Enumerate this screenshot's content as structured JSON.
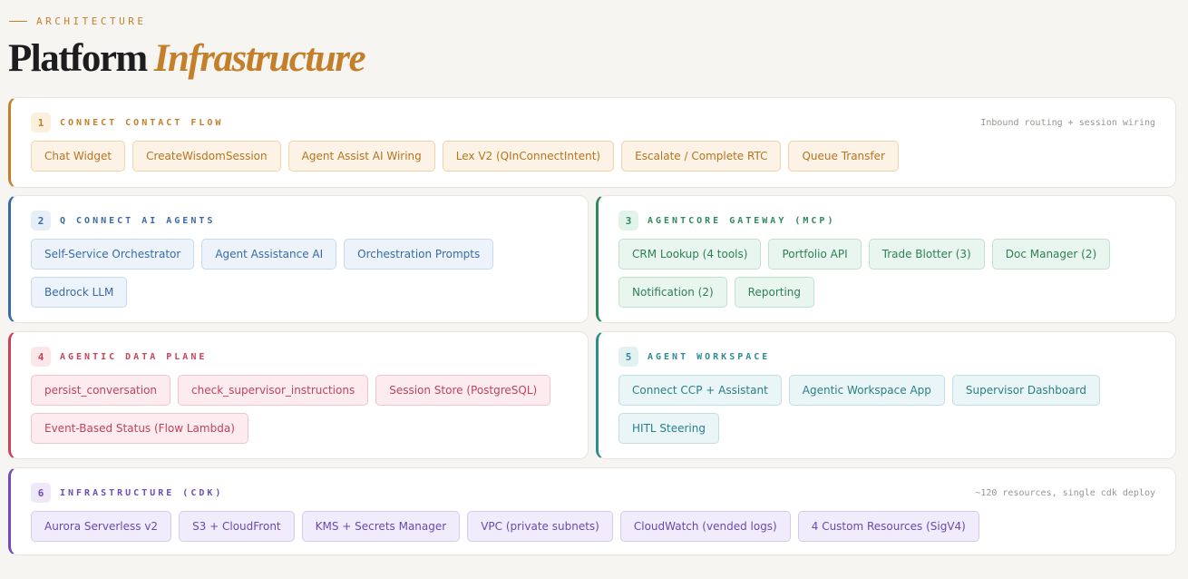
{
  "header": {
    "eyebrow": "ARCHITECTURE",
    "title_main": "Platform",
    "title_accent": "Infrastructure"
  },
  "colors": {
    "background": "#f7f5f1",
    "orange": "#c47f2a",
    "blue": "#3a6aa6",
    "green": "#2e8a5c",
    "red": "#c6455a",
    "teal": "#2f8a92",
    "purple": "#6f4cb8"
  },
  "sections": [
    {
      "number": "1",
      "title": "CONNECT CONTACT FLOW",
      "note": "Inbound routing + session wiring",
      "chips": [
        "Chat Widget",
        "CreateWisdomSession",
        "Agent Assist AI Wiring",
        "Lex V2 (QInConnectIntent)",
        "Escalate / Complete RTC",
        "Queue Transfer"
      ]
    },
    {
      "number": "2",
      "title": "Q CONNECT AI AGENTS",
      "note": "",
      "chips": [
        "Self-Service Orchestrator",
        "Agent Assistance AI",
        "Orchestration Prompts",
        "Bedrock LLM"
      ]
    },
    {
      "number": "3",
      "title": "AGENTCORE GATEWAY (MCP)",
      "note": "",
      "chips": [
        "CRM Lookup (4 tools)",
        "Portfolio API",
        "Trade Blotter (3)",
        "Doc Manager (2)",
        "Notification (2)",
        "Reporting"
      ]
    },
    {
      "number": "4",
      "title": "AGENTIC DATA PLANE",
      "note": "",
      "chips": [
        "persist_conversation",
        "check_supervisor_instructions",
        "Session Store (PostgreSQL)",
        "Event-Based Status (Flow Lambda)"
      ]
    },
    {
      "number": "5",
      "title": "AGENT WORKSPACE",
      "note": "",
      "chips": [
        "Connect CCP + Assistant",
        "Agentic Workspace App",
        "Supervisor Dashboard",
        "HITL Steering"
      ]
    },
    {
      "number": "6",
      "title": "INFRASTRUCTURE (CDK)",
      "note": "~120 resources, single cdk deploy",
      "chips": [
        "Aurora Serverless v2",
        "S3 + CloudFront",
        "KMS + Secrets Manager",
        "VPC (private subnets)",
        "CloudWatch (vended logs)",
        "4 Custom Resources (SigV4)"
      ]
    }
  ]
}
